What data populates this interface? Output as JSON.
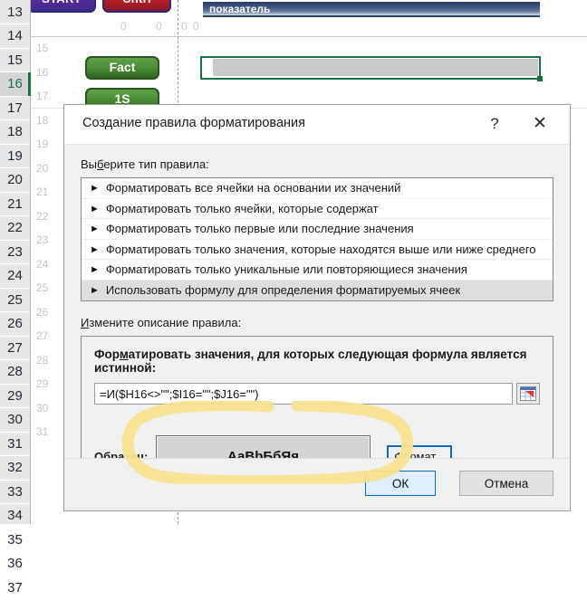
{
  "spreadsheet": {
    "row_headers": [
      "13",
      "14",
      "15",
      "16",
      "17",
      "18",
      "19",
      "20",
      "21",
      "22",
      "23",
      "24",
      "25",
      "26",
      "27",
      "28",
      "29",
      "30",
      "31",
      "32",
      "33",
      "34",
      "35",
      "36",
      "37"
    ],
    "selected_row": "16",
    "inner_row_numbers": [
      "15",
      "16",
      "17",
      "18",
      "19",
      "20",
      "21",
      "22",
      "23",
      "24",
      "25",
      "26",
      "27",
      "28",
      "29",
      "30",
      "31"
    ],
    "macro_buttons": [
      {
        "label": "START",
        "color": "#4a2a95"
      },
      {
        "label": "Cntrl",
        "color": "#bf1f24"
      }
    ],
    "green_buttons": [
      {
        "label": "Fact"
      },
      {
        "label": "1S"
      }
    ],
    "header_bar_label": "показатель",
    "zero_values": [
      "0",
      "0",
      "0",
      "0"
    ]
  },
  "dialog": {
    "title": "Создание правила форматирования",
    "help_glyph": "?",
    "close_glyph": "✕",
    "rule_type_label_pre": "Вы",
    "rule_type_label_u": "б",
    "rule_type_label_post": "ерите тип правила:",
    "rule_types": [
      "Форматировать все ячейки на основании их значений",
      "Форматировать только ячейки, которые содержат",
      "Форматировать только первые или последние значения",
      "Форматировать только значения, которые находятся выше или ниже среднего",
      "Форматировать только уникальные или повторяющиеся значения",
      "Использовать формулу для определения форматируемых ячеек"
    ],
    "selected_rule_index": 5,
    "bullet_glyph": "►",
    "edit_label_pre": "",
    "edit_label_u": "И",
    "edit_label_post": "змените описание правила:",
    "desc_title_pre": "Фор",
    "desc_title_u": "м",
    "desc_title_post": "атировать значения, для которых следующая формула является истинной:",
    "formula_value": "=И($H16<>\"\";$I16=\"\";$J16=\"\")",
    "range_picker_icon": "range-select-icon",
    "sample_label": "Образец:",
    "sample_text": "АаВbБбЯя",
    "format_button_pre": "",
    "format_button_u": "Ф",
    "format_button_post": "ормат...",
    "ok_label": "ОК",
    "cancel_label": "Отмена"
  },
  "annotation": {
    "type": "highlighter-oval",
    "color": "#f7e08f"
  }
}
